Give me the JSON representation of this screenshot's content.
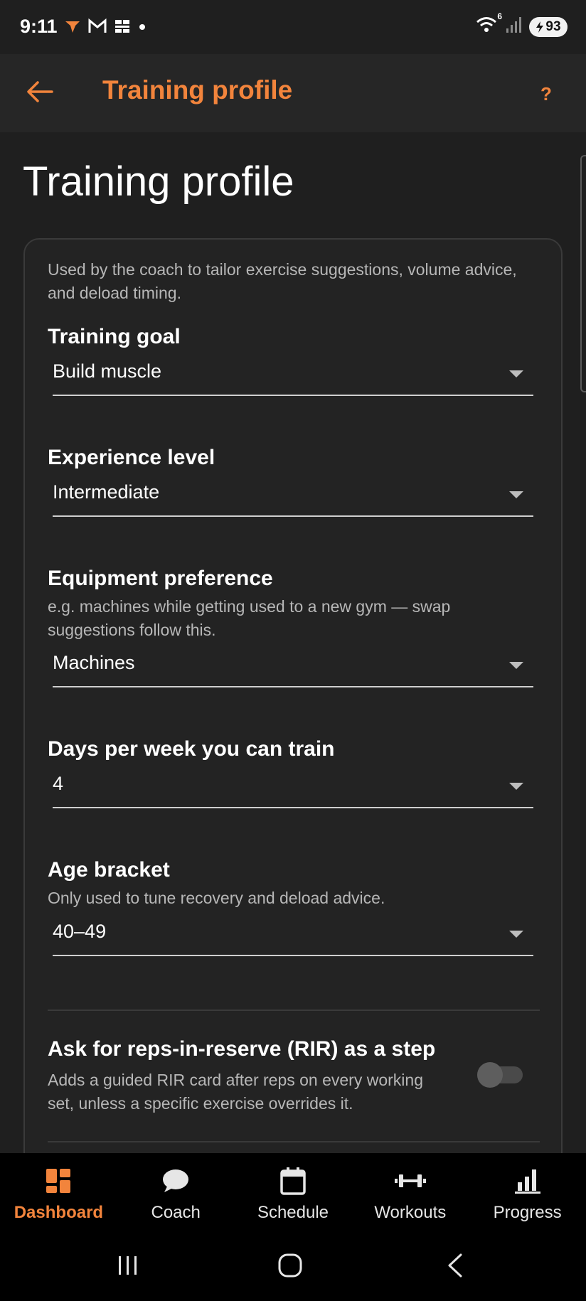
{
  "status_bar": {
    "time": "9:11",
    "battery": "93",
    "network_badge": "6",
    "left_icons": [
      "app-notification-icon",
      "gmail-icon",
      "calendar-icon",
      "dot-icon"
    ],
    "right_icons": [
      "wifi-icon",
      "signal-icon",
      "battery-icon"
    ]
  },
  "app_bar": {
    "title": "Training profile",
    "back_icon": "arrow-left-icon",
    "help_label": "?",
    "accent_color": "#f2843c"
  },
  "page": {
    "title": "Training profile",
    "intro": "Used by the coach to tailor exercise suggestions, volume advice, and deload timing."
  },
  "fields": {
    "goal": {
      "label": "Training goal",
      "value": "Build muscle"
    },
    "experience": {
      "label": "Experience level",
      "value": "Intermediate"
    },
    "equipment": {
      "label": "Equipment preference",
      "help": "e.g. machines while getting used to a new gym — swap suggestions follow this.",
      "value": "Machines"
    },
    "days": {
      "label": "Days per week you can train",
      "value": "4"
    },
    "age": {
      "label": "Age bracket",
      "help": "Only used to tune recovery and deload advice.",
      "value": "40–49"
    },
    "rir": {
      "label": "Ask for reps-in-reserve (RIR) as a step",
      "help": "Adds a guided RIR card after reps on every working set, unless a specific exercise overrides it.",
      "enabled": false
    }
  },
  "bottom_nav": {
    "items": [
      {
        "label": "Dashboard",
        "icon": "dashboard-icon",
        "active": true
      },
      {
        "label": "Coach",
        "icon": "chat-bubble-icon",
        "active": false
      },
      {
        "label": "Schedule",
        "icon": "calendar-icon",
        "active": false
      },
      {
        "label": "Workouts",
        "icon": "dumbbell-icon",
        "active": false
      },
      {
        "label": "Progress",
        "icon": "bar-chart-icon",
        "active": false
      }
    ]
  },
  "system_nav": {
    "icons": [
      "recents-icon",
      "home-icon",
      "back-icon"
    ]
  }
}
